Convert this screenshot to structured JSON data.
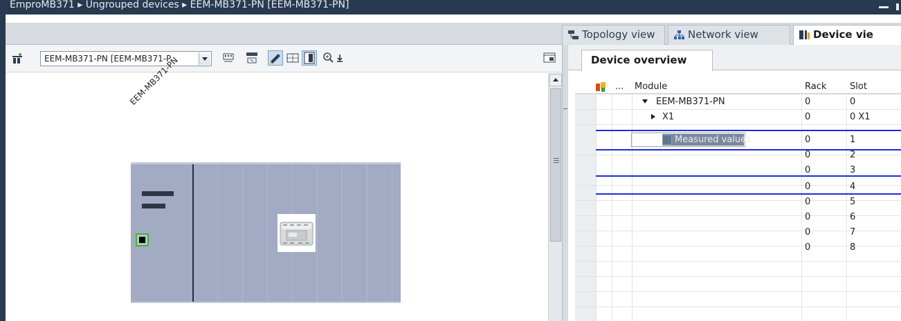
{
  "titlebar": {
    "breadcrumb": "EmproMB371  ▸  Ungrouped devices  ▸  EEM-MB371-PN [EEM-MB371-PN]"
  },
  "views": {
    "topology": "Topology view",
    "network": "Network view",
    "device": "Device vie"
  },
  "toolbar": {
    "device_select_value": "EEM-MB371-PN [EEM-MB371-P"
  },
  "canvas": {
    "device_label": "EEM-MB371-PN"
  },
  "overview": {
    "tab_label": "Device overview",
    "columns": {
      "ellipsis": "...",
      "module": "Module",
      "rack": "Rack",
      "slot": "Slot"
    },
    "rows": [
      {
        "module": "EEM-MB371-PN",
        "rack": "0",
        "slot": "0"
      },
      {
        "module": "X1",
        "rack": "0",
        "slot": "0 X1"
      },
      {
        "module": "Measured values",
        "rack": "0",
        "slot": "1"
      },
      {
        "module": "",
        "rack": "0",
        "slot": "2"
      },
      {
        "module": "",
        "rack": "0",
        "slot": "3"
      },
      {
        "module": "",
        "rack": "0",
        "slot": "4"
      },
      {
        "module": "",
        "rack": "0",
        "slot": "5"
      },
      {
        "module": "",
        "rack": "0",
        "slot": "6"
      },
      {
        "module": "",
        "rack": "0",
        "slot": "7"
      },
      {
        "module": "",
        "rack": "0",
        "slot": "8"
      }
    ]
  },
  "colors": {
    "titlebar_bg": "#283a50",
    "rack_bg": "#a3aac4",
    "selection_line": "#1a2ddb",
    "port_border": "#3dbb2e"
  },
  "icons": [
    "window-minimize-icon",
    "topology-view-icon",
    "network-view-icon",
    "device-view-icon",
    "device-connect-icon",
    "dropdown-arrow-icon",
    "show-interfaces-icon",
    "show-names-icon",
    "edit-mode-icon",
    "grid-icon",
    "page-break-icon",
    "zoom-icon",
    "zoom-dropdown-icon",
    "overview-toggle-icon",
    "diagnostics-icon",
    "scroll-up-icon",
    "splitter-grip-icon",
    "expand-down-icon",
    "expand-right-icon",
    "module-icon",
    "device-image-icon",
    "ethernet-port-icon"
  ]
}
